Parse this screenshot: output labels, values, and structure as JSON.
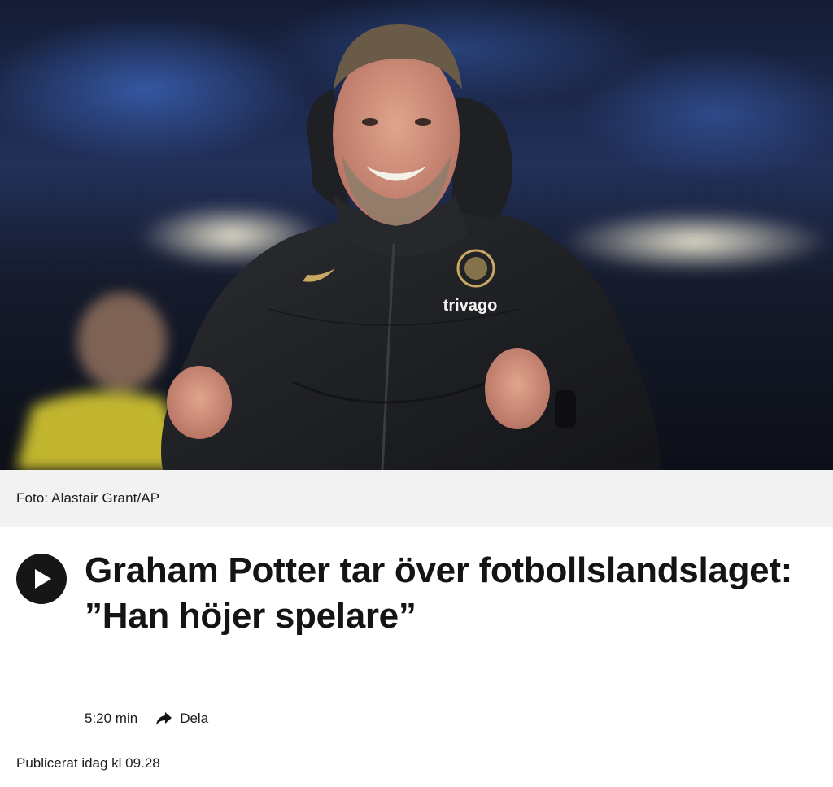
{
  "hero": {
    "image_description_icon": "photo",
    "jacket_text": "trivago"
  },
  "caption": {
    "text": "Foto: Alastair Grant/AP"
  },
  "article": {
    "headline": "Graham Potter tar över fotbollslandslaget: ”Han höjer spelare”",
    "duration": "5:20 min",
    "share_label": "Dela",
    "published": "Publicerat idag kl 09.28",
    "play_icon": "play-icon",
    "share_icon": "share-arrow-icon"
  }
}
